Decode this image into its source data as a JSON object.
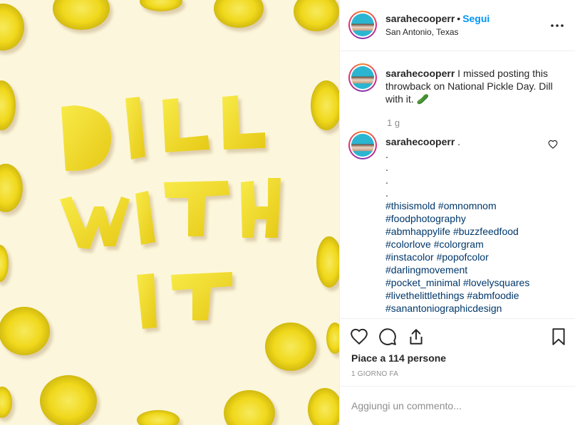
{
  "post": {
    "username": "sarahecooperr",
    "follow_separator": "•",
    "follow_label": "Segui",
    "location": "San Antonio, Texas"
  },
  "photo": {
    "text_line1": "DILL",
    "text_line2": "WITH",
    "text_line3": "IT",
    "background_color": "#fcf7dc",
    "pickle_color": "#f2dc1e"
  },
  "caption": {
    "username": "sarahecooperr",
    "text": "I missed posting this throwback on National Pickle Day. Dill with it.",
    "emoji": "🥒",
    "time": "1 g"
  },
  "comment": {
    "username": "sarahecooperr",
    "first": ".",
    "dots": [
      ".",
      ".",
      ".",
      "."
    ],
    "hashtag_lines": [
      "#thisismold #omnomnom",
      "#foodphotography",
      "#abmhappylife #buzzfeedfood",
      "#colorlove #colorgram",
      "#instacolor #popofcolor",
      "#darlingmovement",
      "#pocket_minimal #lovelysquares",
      "#livethelittlethings #abmfoodie",
      "#sanantoniographicdesign"
    ]
  },
  "actions": {
    "likes_text": "Piace a 114 persone",
    "time_ago": "1 GIORNO FA",
    "icons": [
      "heart-icon",
      "comment-icon",
      "share-icon",
      "bookmark-icon"
    ]
  },
  "add_comment": {
    "placeholder": "Aggiungi un commento..."
  }
}
